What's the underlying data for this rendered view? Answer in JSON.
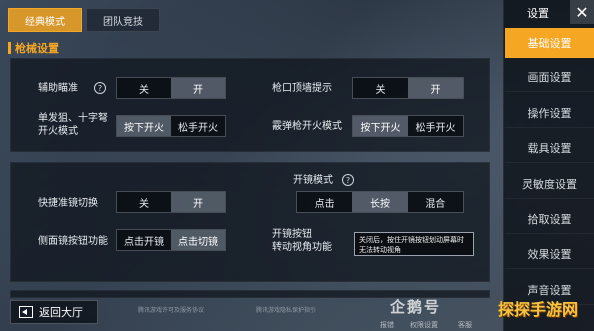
{
  "top_tabs": [
    "经典模式",
    "团队竞技"
  ],
  "section_title": "枪械设置",
  "rows": {
    "aim_assist": {
      "label": "辅助瞄准",
      "options": [
        "关",
        "开"
      ],
      "selected": 1
    },
    "wall_hint": {
      "label": "枪口顶墙提示",
      "options": [
        "关",
        "开"
      ],
      "selected": 1
    },
    "single_fire": {
      "label": "单发狙、十字弩\n开火模式",
      "options": [
        "按下开火",
        "松手开火"
      ],
      "selected": 0
    },
    "shotgun_fire": {
      "label": "霰弹枪开火模式",
      "options": [
        "按下开火",
        "松手开火"
      ],
      "selected": 0
    },
    "scope_mode": {
      "label": "开镜模式",
      "options": [
        "点击",
        "长按",
        "混合"
      ],
      "selected": 1
    },
    "quick_scope": {
      "label": "快捷准镜切换",
      "options": [
        "关",
        "开"
      ],
      "selected": 1
    },
    "side_scope": {
      "label": "侧面镜按钮功能",
      "options": [
        "点击开镜",
        "点击切镜"
      ],
      "selected": 1
    },
    "scope_button": {
      "label": "开镜按钮\n转动视角功能",
      "options": [
        ""
      ],
      "selected": -1
    }
  },
  "tooltip": "关闭后，按住开镜按钮划动屏幕时无法转动视角",
  "back_label": "返回大厅",
  "footer": [
    "腾讯游戏许可及服务协议",
    "腾讯游戏隐私保护指引"
  ],
  "watermark": "企鹅号",
  "watermark_brand": "探探手游网",
  "watermark_sub": [
    "报错",
    "权限设置",
    "客服"
  ],
  "sidebar": {
    "title": "设置",
    "close_glyph": "✕",
    "items": [
      "基础设置",
      "画面设置",
      "操作设置",
      "载具设置",
      "灵敏度设置",
      "拾取设置",
      "效果设置",
      "声音设置"
    ],
    "active_index": 0
  },
  "help_glyph": "?"
}
